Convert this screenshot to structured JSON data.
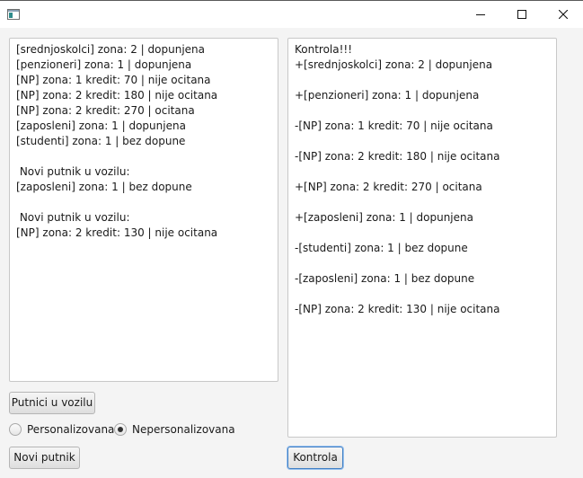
{
  "window": {
    "icon": "app-window-icon",
    "controls": [
      "minimize-icon",
      "maximize-icon",
      "close-icon"
    ]
  },
  "left_panel": {
    "lines": [
      "[srednjoskolci] zona: 2 | dopunjena",
      "[penzioneri] zona: 1 | dopunjena",
      "[NP] zona: 1 kredit: 70 | nije ocitana",
      "[NP] zona: 2 kredit: 180 | nije ocitana",
      "[NP] zona: 2 kredit: 270 | ocitana",
      "[zaposleni] zona: 1 | dopunjena",
      "[studenti] zona: 1 | bez dopune",
      "",
      " Novi putnik u vozilu:",
      "[zaposleni] zona: 1 | bez dopune",
      "",
      " Novi putnik u vozilu:",
      "[NP] zona: 2 kredit: 130 | nije ocitana"
    ]
  },
  "right_panel": {
    "lines": [
      "Kontrola!!!",
      "+[srednjoskolci] zona: 2 | dopunjena",
      "",
      "+[penzioneri] zona: 1 | dopunjena",
      "",
      "-[NP] zona: 1 kredit: 70 | nije ocitana",
      "",
      "-[NP] zona: 2 kredit: 180 | nije ocitana",
      "",
      "+[NP] zona: 2 kredit: 270 | ocitana",
      "",
      "+[zaposleni] zona: 1 | dopunjena",
      "",
      "-[studenti] zona: 1 | bez dopune",
      "",
      "-[zaposleni] zona: 1 | bez dopune",
      "",
      "-[NP] zona: 2 kredit: 130 | nije ocitana"
    ]
  },
  "buttons": {
    "passengers": "Putnici u vozilu",
    "new_passenger": "Novi putnik",
    "control": "Kontrola"
  },
  "radios": {
    "personal": {
      "label": "Personalizovana",
      "selected": false
    },
    "nonpersonal": {
      "label": "Nepersonalizovana",
      "selected": true
    }
  }
}
